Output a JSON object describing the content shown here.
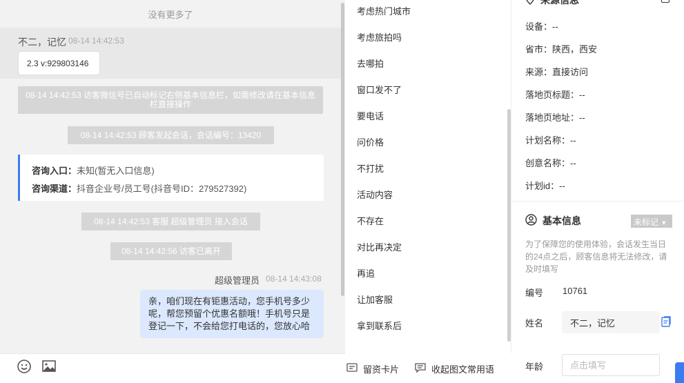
{
  "chat": {
    "no_more": "没有更多了",
    "visitor": {
      "name": "不二，记忆",
      "time": "08-14 14:42:53",
      "message": "2.3 v:929803146"
    },
    "system_messages": [
      "08-14 14:42:53 访客微信号已自动标记右侧基本信息栏，如需修改请在基本信息栏直接操作",
      "08-14 14:42:53 顾客发起会话，会话编号：13420",
      "08-14 14:42:53 客服 超级管理员 接入会话",
      "08-14 14:42:56 访客已离开"
    ],
    "consult": {
      "entry_label": "咨询入口：",
      "entry_value": "未知(暂无入口信息)",
      "channel_label": "咨询渠道：",
      "channel_value": "抖音企业号/员工号(抖音号ID：279527392)"
    },
    "agent": {
      "name": "超级管理员",
      "time": "08-14 14:43:08",
      "message": "亲，咱们现在有钜惠活动，您手机号多少呢，帮您预留个优惠名额哦！手机号只是登记一下，不会给您打电话的，您放心哈"
    },
    "toolbar": {
      "emoji_icon": "smiley-icon",
      "image_icon": "image-icon"
    }
  },
  "quick_replies": {
    "items": [
      "考虑热门城市",
      "考虑旅拍吗",
      "去哪拍",
      "窗口发不了",
      "要电话",
      "问价格",
      "不打扰",
      "活动内容",
      "不存在",
      "对比再决定",
      "再追",
      "让加客服",
      "拿到联系后"
    ],
    "footer": {
      "leave_card": "留资卡片",
      "collapse": "收起图文常用语"
    }
  },
  "info": {
    "source_title": "来源信息",
    "source": [
      "设备：--",
      "省市：陕西，西安",
      "来源：直接访问",
      "落地页标题：--",
      "落地页地址：--",
      "计划名称：--",
      "创意名称：--",
      "计划id：--"
    ],
    "basic": {
      "title": "基本信息",
      "badge": "未标记",
      "notice": "为了保障您的使用体验，会话发生当日的24点之后，顾客信息将无法修改，请及时填写",
      "id_label": "编号",
      "id_value": "10761",
      "name_label": "姓名",
      "name_value": "不二，记忆",
      "age_label": "年龄",
      "age_placeholder": "点击填写"
    }
  }
}
